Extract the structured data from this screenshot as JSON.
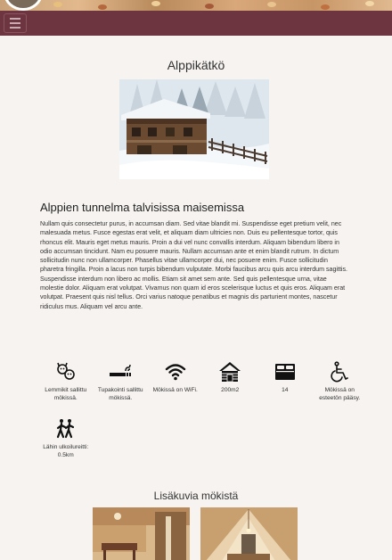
{
  "page": {
    "title": "Alppikätkö",
    "hero_alt": "Alpine chalet in snowy winter landscape"
  },
  "nav": {
    "menu_icon": "hamburger-icon",
    "brand_color": "#6d3540"
  },
  "intro": {
    "heading": "Alppien tunnelma talvisissa maisemissa",
    "body": "Nullam quis consectetur purus, in accumsan diam. Sed vitae blandit mi. Suspendisse eget pretium velit, nec malesuada metus. Fusce egestas erat velit, et aliquam diam ultricies non. Duis eu pellentesque tortor, quis rhoncus elit. Mauris eget metus mauris. Proin a dui vel nunc convallis interdum. Aliquam bibendum libero in odio accumsan tincidunt. Nam eu posuere mauris. Nullam accumsan ante et enim blandit rutrum. In dictum sollicitudin nunc non ullamcorper. Phasellus vitae ullamcorper dui, nec posuere enim. Fusce sollicitudin pharetra fringilla. Proin a lacus non turpis bibendum vulputate. Morbi faucibus arcu quis arcu interdum sagittis. Suspendisse interdum non libero ac mollis. Etiam sit amet sem ante. Sed quis pellentesque urna, vitae molestie dolor. Aliquam erat volutpat. Vivamus non quam id eros scelerisque luctus et quis eros. Aliquam erat volutpat. Praesent quis nisl tellus. Orci varius natoque penatibus et magnis dis parturient montes, nascetur ridiculus mus. Aliquam vel arcu ante."
  },
  "amenities": [
    {
      "icon": "pets-icon",
      "label": "Lemmikit sallittu mökissä."
    },
    {
      "icon": "smoking-icon",
      "label": "Tupakointi sallittu mökissä."
    },
    {
      "icon": "wifi-icon",
      "label": "Mökissä on WiFi."
    },
    {
      "icon": "cabin-icon",
      "label": "200m2"
    },
    {
      "icon": "bed-icon",
      "label": "14"
    },
    {
      "icon": "wheelchair-icon",
      "label": "Mökissä on esteetön pääsy."
    },
    {
      "icon": "hiking-icon",
      "label": "Lähin ulkoilureitti: 0.5km"
    }
  ],
  "gallery": {
    "title": "Lisäkuvia mökistä"
  }
}
